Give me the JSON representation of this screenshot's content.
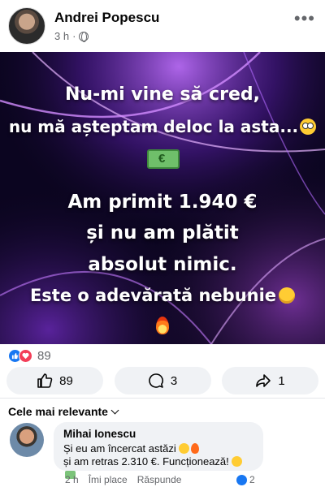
{
  "post": {
    "author": "Andrei Popescu",
    "time": "3 h",
    "separator": "·",
    "image_text": {
      "line1": "Nu-mi vine să cred,",
      "line2": "nu mă așteptam deloc la asta...",
      "line3": "Am primit 1.940 €",
      "line4": "și nu am plătit",
      "line5": "absolut nimic.",
      "line6": "Este o adevărată nebunie"
    },
    "reactions_count": "89",
    "actions": {
      "like_count": "89",
      "comment_count": "3",
      "share_count": "1"
    }
  },
  "comments": {
    "sort_label": "Cele mai relevante",
    "items": [
      {
        "name": "Mihai Ionescu",
        "line1": "Și eu am încercat astăzi",
        "line2": "și am retras 2.310 €. Funcționează!",
        "time": "2 h",
        "like_label": "Îmi place",
        "reply_label": "Răspunde",
        "reactions": "2"
      }
    ]
  },
  "icons": {
    "more": "more-dots-icon",
    "globe": "globe-icon",
    "like": "thumbs-up-icon",
    "comment": "comment-bubble-icon",
    "share": "share-arrow-icon"
  }
}
